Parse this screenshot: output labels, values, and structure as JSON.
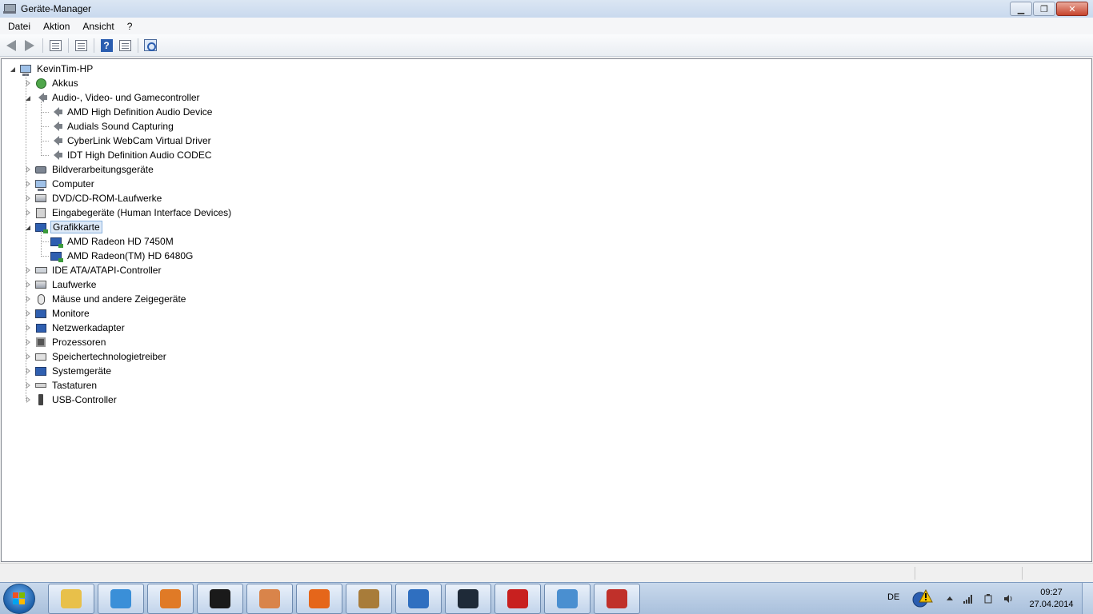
{
  "window": {
    "title": "Geräte-Manager",
    "buttons": {
      "minimize": "▁",
      "maximize": "❐",
      "close": "✕"
    }
  },
  "menu": [
    "Datei",
    "Aktion",
    "Ansicht",
    "?"
  ],
  "toolbar": {
    "icons": [
      "back-arrow-icon",
      "forward-arrow-icon",
      "console-tree-icon",
      "properties-icon",
      "help-icon",
      "action-pane-icon",
      "scan-hardware-icon"
    ]
  },
  "tree": {
    "root": "KevinTim-HP",
    "items": [
      {
        "label": "Akkus",
        "icon": "battery-icon",
        "expanded": false
      },
      {
        "label": "Audio-, Video- und Gamecontroller",
        "icon": "speaker-icon",
        "expanded": true,
        "children": [
          "AMD High Definition Audio Device",
          "Audials Sound Capturing",
          "CyberLink WebCam Virtual Driver",
          "IDT High Definition Audio CODEC"
        ]
      },
      {
        "label": "Bildverarbeitungsgeräte",
        "icon": "camera-icon",
        "expanded": false
      },
      {
        "label": "Computer",
        "icon": "computer-icon",
        "expanded": false
      },
      {
        "label": "DVD/CD-ROM-Laufwerke",
        "icon": "disc-drive-icon",
        "expanded": false
      },
      {
        "label": "Eingabegeräte (Human Interface Devices)",
        "icon": "hid-icon",
        "expanded": false
      },
      {
        "label": "Grafikkarte",
        "icon": "display-adapter-icon",
        "expanded": true,
        "selected": true,
        "children": [
          "AMD Radeon HD 7450M",
          "AMD Radeon(TM) HD 6480G"
        ]
      },
      {
        "label": "IDE ATA/ATAPI-Controller",
        "icon": "ide-icon",
        "expanded": false
      },
      {
        "label": "Laufwerke",
        "icon": "disk-drive-icon",
        "expanded": false
      },
      {
        "label": "Mäuse und andere Zeigegeräte",
        "icon": "mouse-icon",
        "expanded": false
      },
      {
        "label": "Monitore",
        "icon": "monitor-icon",
        "expanded": false
      },
      {
        "label": "Netzwerkadapter",
        "icon": "network-icon",
        "expanded": false
      },
      {
        "label": "Prozessoren",
        "icon": "processor-icon",
        "expanded": false
      },
      {
        "label": "Speichertechnologietreiber",
        "icon": "storage-icon",
        "expanded": false
      },
      {
        "label": "Systemgeräte",
        "icon": "system-devices-icon",
        "expanded": false
      },
      {
        "label": "Tastaturen",
        "icon": "keyboard-icon",
        "expanded": false
      },
      {
        "label": "USB-Controller",
        "icon": "usb-icon",
        "expanded": false
      }
    ]
  },
  "taskbar": {
    "apps": [
      "explorer",
      "internet-explorer",
      "media-player",
      "hp",
      "paint",
      "firefox",
      "game",
      "window",
      "steam",
      "acrobat",
      "control-panel",
      "toolbox"
    ],
    "language": "DE",
    "clock_time": "09:27",
    "clock_date": "27.04.2014"
  }
}
